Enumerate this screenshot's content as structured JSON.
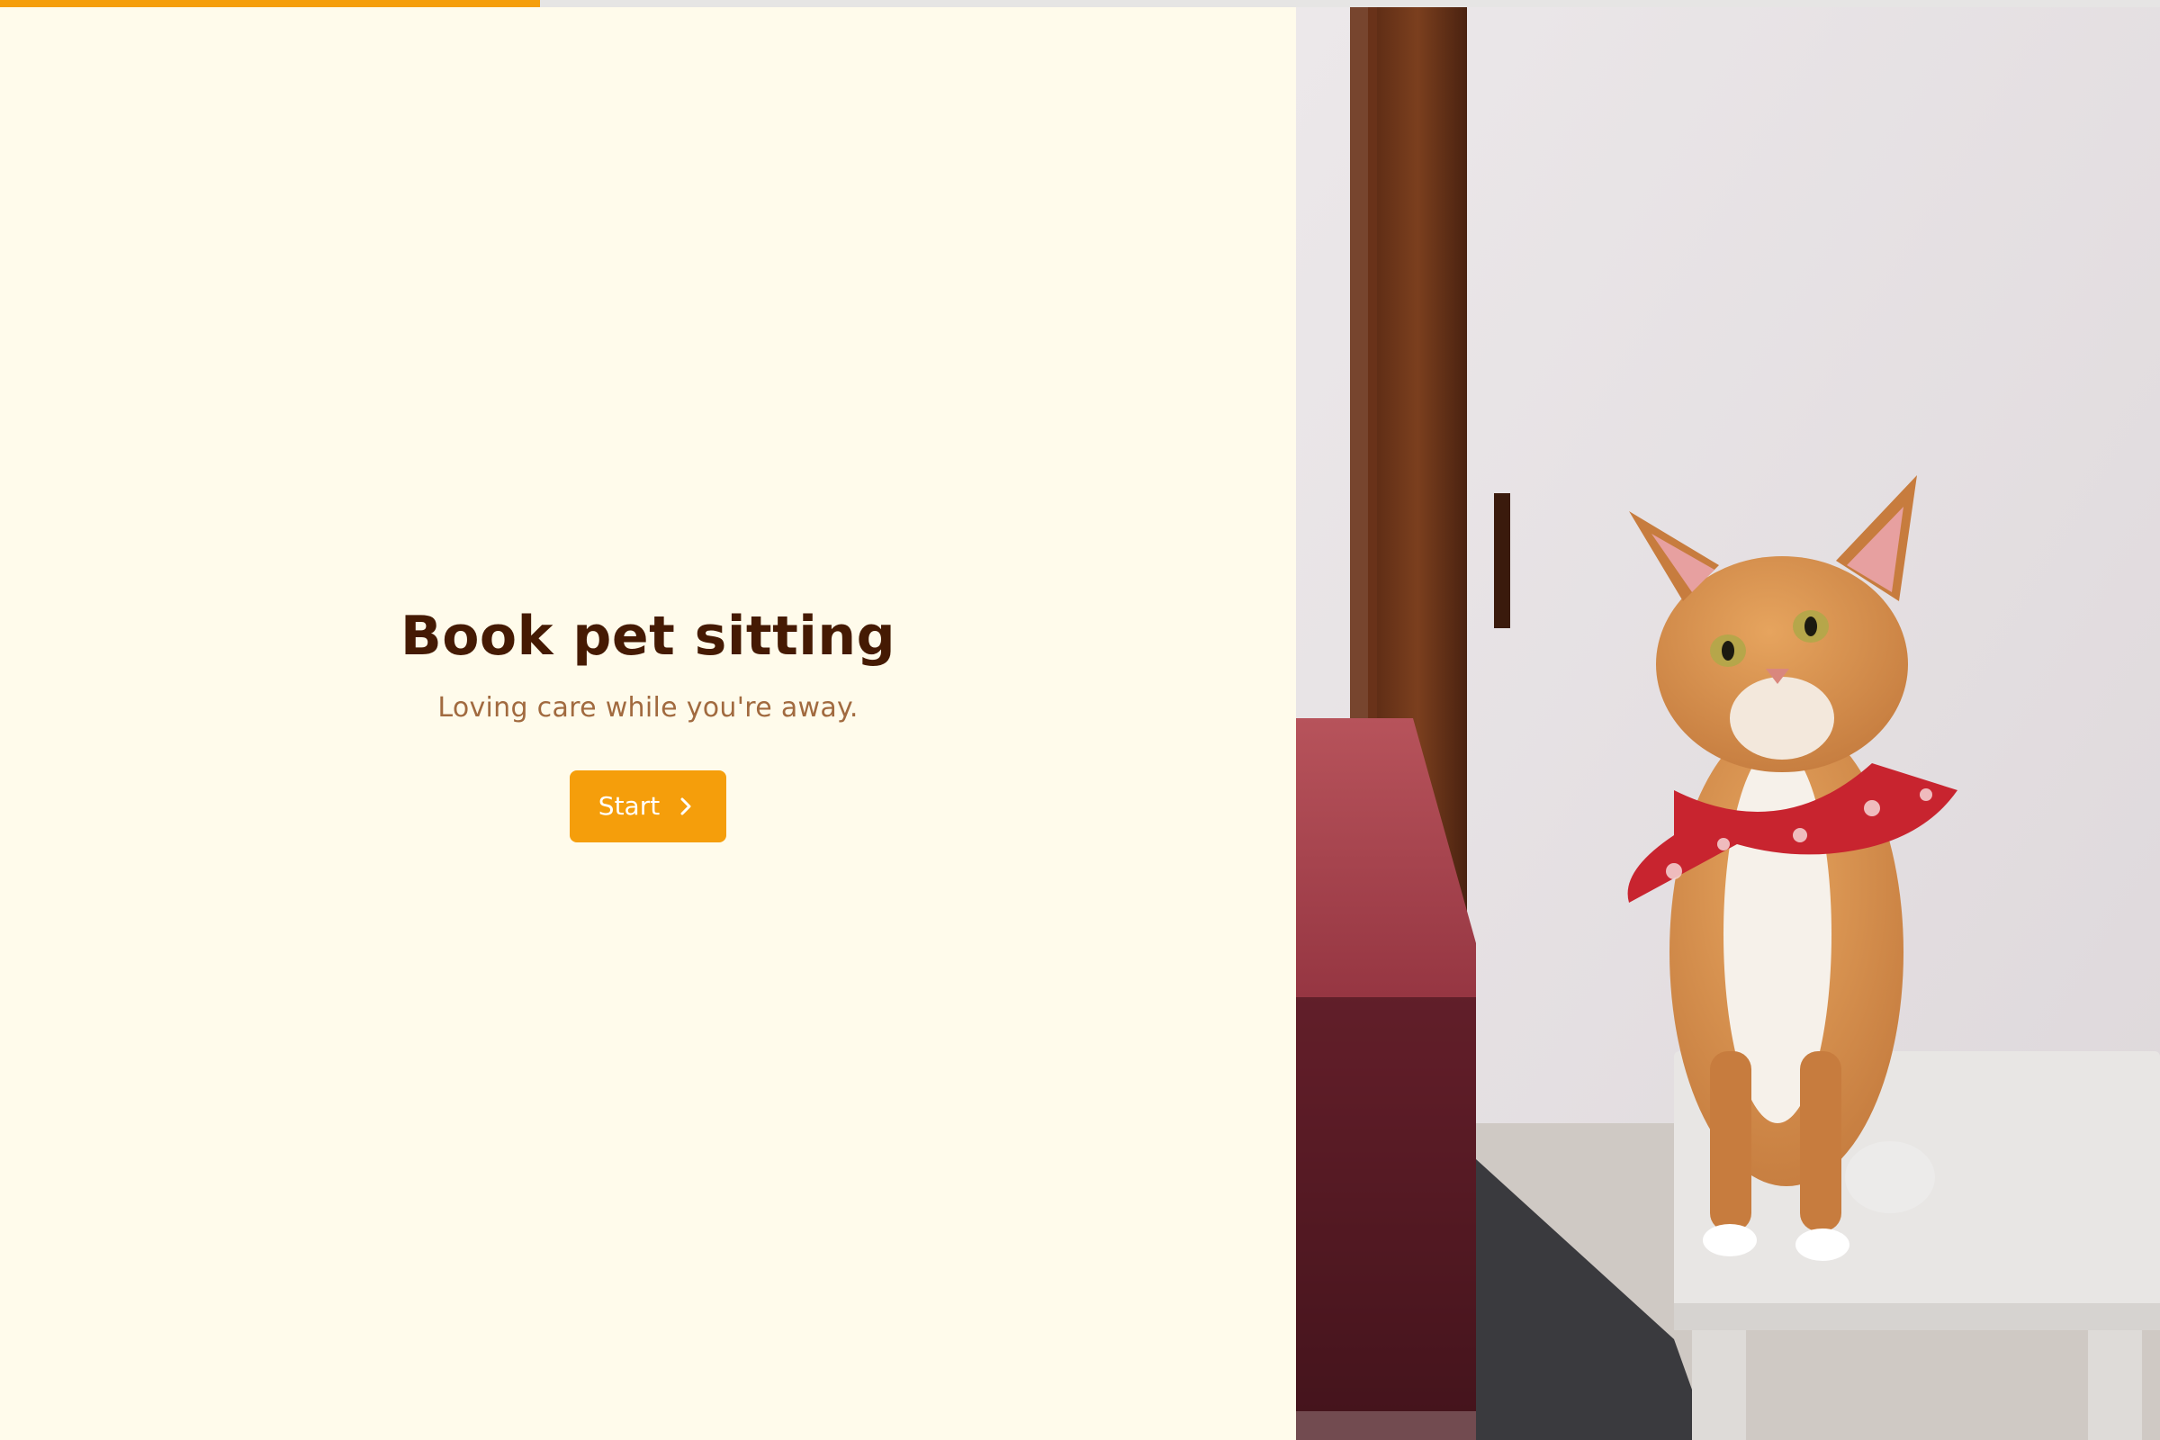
{
  "progress": {
    "value": 0.25,
    "fill_color": "#f59e0b",
    "track_color": "#e6e5e4"
  },
  "hero": {
    "title": "Book pet sitting",
    "subtitle": "Loving care while you're away.",
    "start_label": "Start",
    "start_icon": "chevron-right-icon"
  },
  "colors": {
    "background": "#fffbeb",
    "title": "#451a03",
    "subtitle": "#a16a3f",
    "accent": "#f59e0b"
  },
  "photo": {
    "subject": "ginger-cat-with-red-bandana"
  }
}
